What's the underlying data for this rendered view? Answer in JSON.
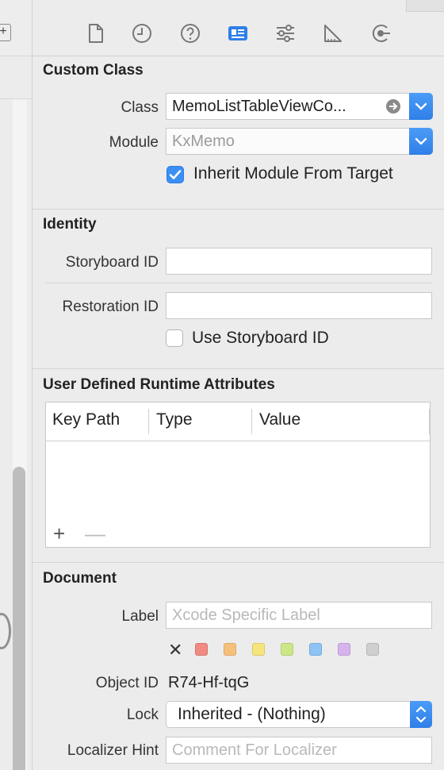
{
  "toolbar": {
    "icons": [
      "file-inspector-icon",
      "history-inspector-icon",
      "quick-help-icon",
      "identity-inspector-icon",
      "attributes-inspector-icon",
      "size-inspector-icon",
      "connections-inspector-icon"
    ],
    "accent_color": "#2f7fe8"
  },
  "left_strip": {
    "plus_glyph": "+"
  },
  "custom_class": {
    "title": "Custom Class",
    "class_label": "Class",
    "class_value": "MemoListTableViewCo...",
    "module_label": "Module",
    "module_placeholder": "KxMemo",
    "inherit_label": "Inherit Module From Target",
    "inherit_checked": true
  },
  "identity": {
    "title": "Identity",
    "storyboard_id_label": "Storyboard ID",
    "storyboard_id_value": "",
    "restoration_id_label": "Restoration ID",
    "restoration_id_value": "",
    "use_storyboard_label": "Use Storyboard ID",
    "use_storyboard_checked": false
  },
  "runtime_attributes": {
    "title": "User Defined Runtime Attributes",
    "columns": [
      "Key Path",
      "Type",
      "Value"
    ],
    "rows": [],
    "add_glyph": "+",
    "remove_glyph": "—"
  },
  "document": {
    "title": "Document",
    "label_label": "Label",
    "label_placeholder": "Xcode Specific Label",
    "clear_glyph": "✕",
    "label_colors": [
      "#f08a83",
      "#f5c17a",
      "#f6e47d",
      "#cde688",
      "#8ec3f5",
      "#d6b3ec",
      "#cfcfcf"
    ],
    "object_id_label": "Object ID",
    "object_id_value": "R74-Hf-tqG",
    "lock_label": "Lock",
    "lock_value": "Inherited - (Nothing)",
    "localizer_label": "Localizer Hint",
    "localizer_placeholder": "Comment For Localizer"
  }
}
